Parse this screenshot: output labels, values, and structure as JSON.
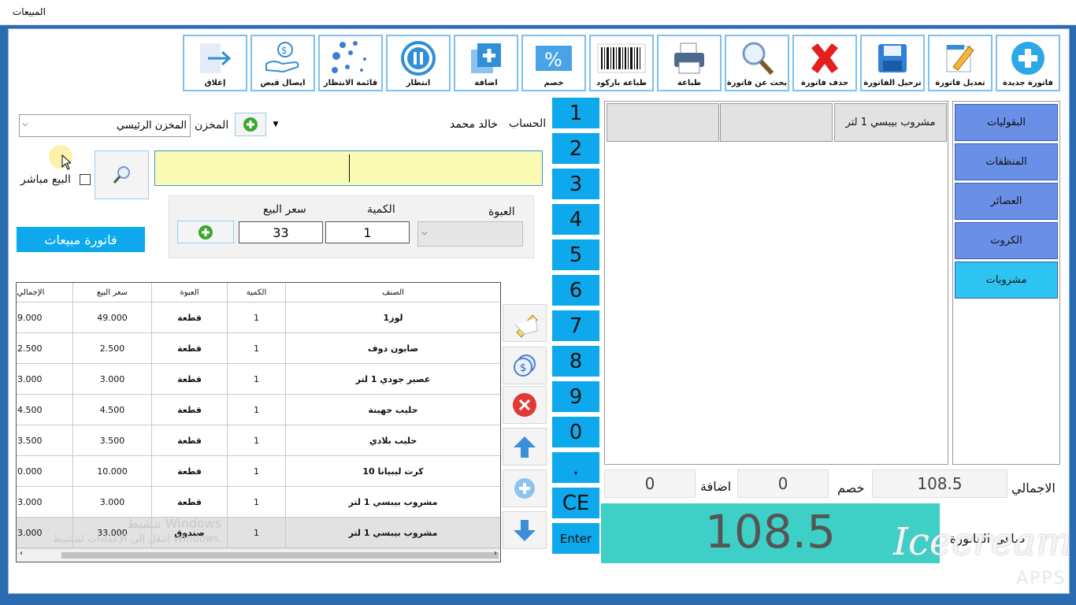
{
  "window": {
    "title": "المبيعات"
  },
  "toolbar": [
    {
      "name": "new-invoice-button",
      "label": "فاتورة جديدة",
      "icon": "plus-circle-icon"
    },
    {
      "name": "edit-invoice-button",
      "label": "تعديل فاتورة",
      "icon": "pencil-edit-icon"
    },
    {
      "name": "post-invoice-button",
      "label": "ترحيل الفاتورة",
      "icon": "floppy-save-icon"
    },
    {
      "name": "delete-invoice-button",
      "label": "حذف فاتورة",
      "icon": "red-x-icon"
    },
    {
      "name": "search-invoice-button",
      "label": "بحث عن فاتورة",
      "icon": "magnifier-icon"
    },
    {
      "name": "print-button",
      "label": "طباعة",
      "icon": "printer-icon"
    },
    {
      "name": "print-barcode-button",
      "label": "طباعة باركود",
      "icon": "barcode-icon"
    },
    {
      "name": "discount-button",
      "label": "خصم",
      "icon": "percent-icon"
    },
    {
      "name": "add-button",
      "label": "اضافة",
      "icon": "plus-square-icon"
    },
    {
      "name": "hold-button",
      "label": "انتظار",
      "icon": "pause-icon"
    },
    {
      "name": "waiting-list-button",
      "label": "قائمة الانتظار",
      "icon": "dots-icon"
    },
    {
      "name": "receipt-button",
      "label": "ايصال قبض",
      "icon": "money-hand-icon"
    },
    {
      "name": "close-button",
      "label": "إغلاق",
      "icon": "exit-arrow-icon"
    }
  ],
  "form": {
    "account_label": "الحساب",
    "account_value": "خالد محمد",
    "store_label": "المخزن",
    "store_value": "المخزن الرئيسي",
    "direct_sale_label": "البيع مباشر",
    "package_label": "العبوة",
    "quantity_label": "الكمية",
    "quantity_value": "1",
    "price_label": "سعر البيع",
    "price_value": "33",
    "sales_invoice_label": "فاتورة مبيعات"
  },
  "grid": {
    "headers": [
      "الصنف",
      "الكمية",
      "العبوة",
      "سعر البيع",
      "الإجمالي"
    ],
    "rows": [
      [
        "لوز1",
        "1",
        "قطعة",
        "49.000",
        "9.000"
      ],
      [
        "صابون دوف",
        "1",
        "قطعة",
        "2.500",
        "2.500"
      ],
      [
        "عصير جودي 1 لتر",
        "1",
        "قطعة",
        "3.000",
        "3.000"
      ],
      [
        "حليب جهينة",
        "1",
        "قطعة",
        "4.500",
        "4.500"
      ],
      [
        "حليب بلادي",
        "1",
        "قطعة",
        "3.500",
        "3.500"
      ],
      [
        "كرت ليبيانا 10",
        "1",
        "قطعة",
        "10.000",
        "0.000"
      ],
      [
        "مشروب بيبسي 1 لتر",
        "1",
        "قطعة",
        "3.000",
        "3.000"
      ],
      [
        "مشروب بيبسي 1 لتر",
        "1",
        "صندوق",
        "33.000",
        "3.000"
      ]
    ],
    "watermark_line1": "تنشيط Windows",
    "watermark_line2": "انتقل إلى الإعدادات لتنشيط Windows."
  },
  "keypad": [
    "1",
    "2",
    "3",
    "4",
    "5",
    "6",
    "7",
    "8",
    "9",
    "0",
    ".",
    "CE",
    "Enter"
  ],
  "categories": [
    "البقوليات",
    "المنظفات",
    "العصائر",
    "الكروت",
    "مشروبات"
  ],
  "products": [
    "مشروب بيبسي 1 لتر",
    "",
    ""
  ],
  "totals": {
    "total_label": "الاجمالي",
    "total_value": "108.5",
    "discount_label": "خصم",
    "discount_value": "0",
    "addition_label": "اضافة",
    "addition_value": "0",
    "net_label": "صافي الفاتورة",
    "net_value": "108.5"
  },
  "brand": {
    "line1": "Icecream",
    "line2": "APPS"
  }
}
